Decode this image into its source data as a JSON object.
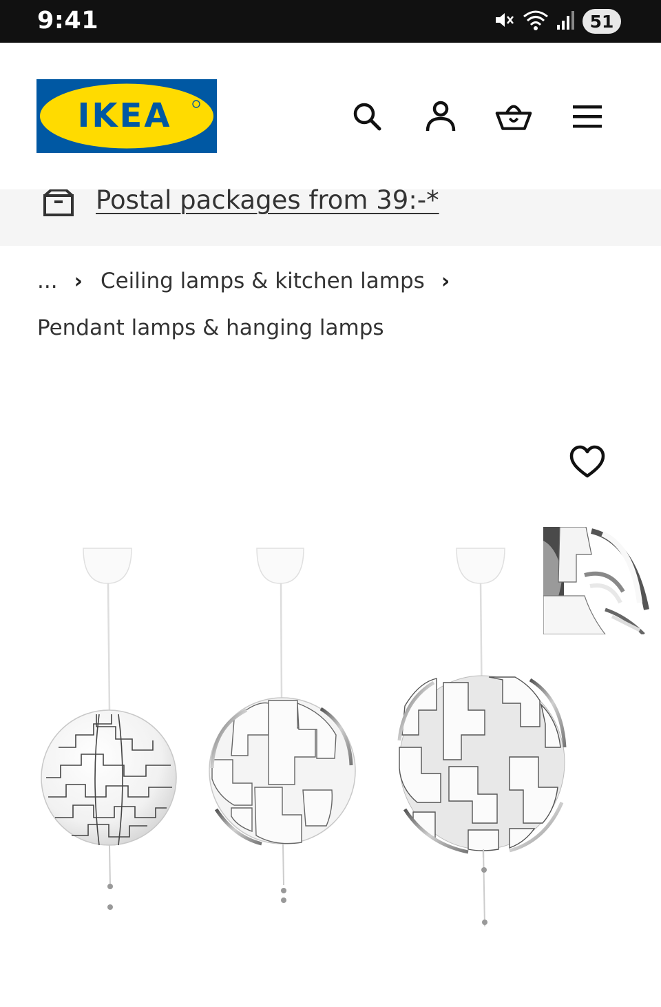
{
  "status_bar": {
    "time": "9:41",
    "battery": "51",
    "icons": [
      "mute-icon",
      "wifi-icon",
      "signal-icon"
    ]
  },
  "header": {
    "logo_text": "IKEA",
    "icons": [
      "search-icon",
      "account-icon",
      "basket-icon",
      "menu-icon"
    ],
    "colors": {
      "brand_blue": "#0058a3",
      "brand_yellow": "#ffdb00"
    }
  },
  "promo": {
    "text": "Postal packages from 39:-*",
    "icon": "package-icon"
  },
  "breadcrumb": {
    "ellipsis": "...",
    "separator": "›",
    "level1": "Ceiling lamps & kitchen lamps",
    "level2": "Pendant lamps & hanging lamps"
  },
  "product": {
    "favourite_icon": "heart-icon",
    "image": "pendant-lamps-image",
    "thumbnail": "lamp-detail-thumbnail"
  }
}
